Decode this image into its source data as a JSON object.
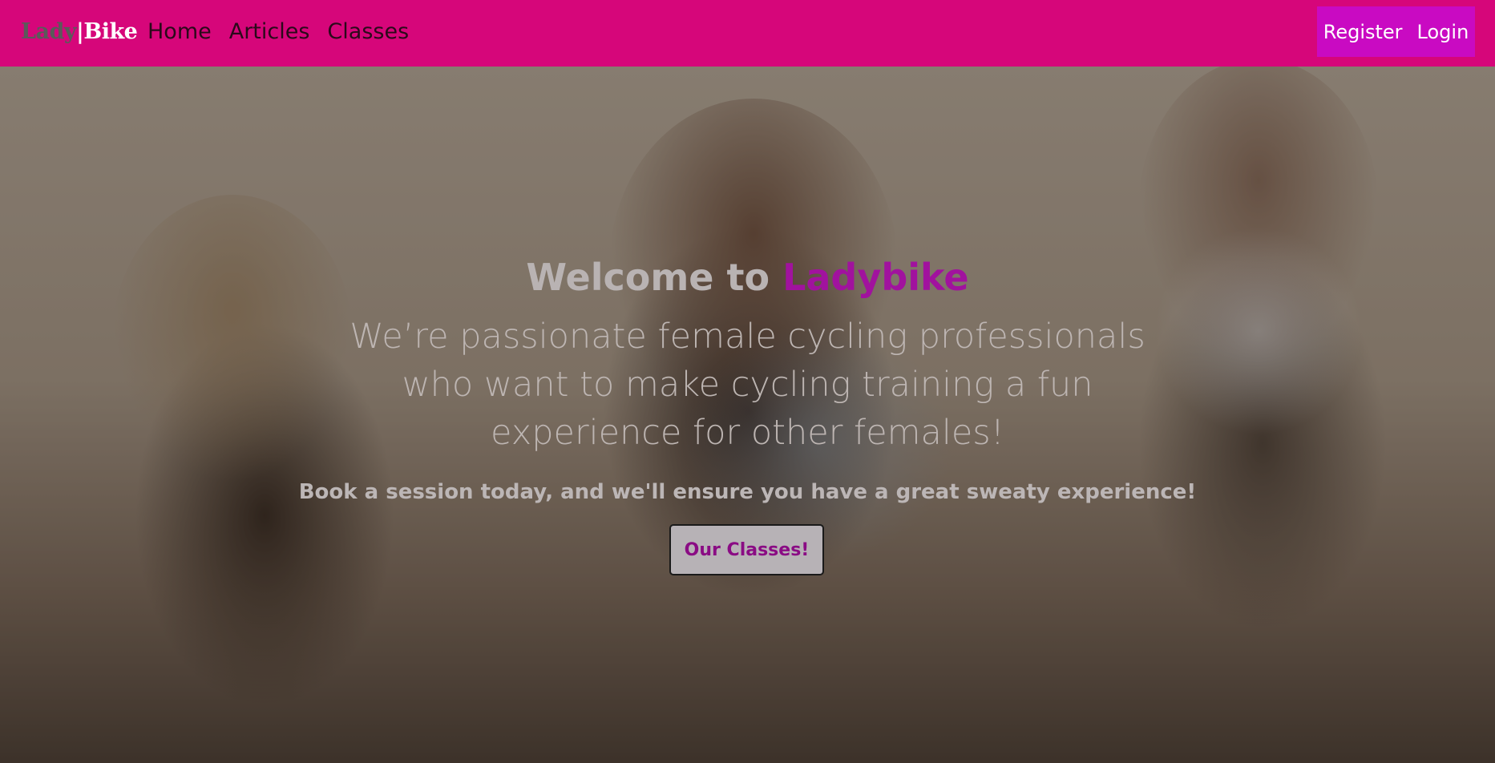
{
  "brand": {
    "part1": "Lady",
    "separator": "|",
    "part2": "Bike"
  },
  "nav": {
    "items": [
      {
        "label": "Home"
      },
      {
        "label": "Articles"
      },
      {
        "label": "Classes"
      }
    ]
  },
  "auth": {
    "register_label": "Register",
    "login_label": "Login"
  },
  "hero": {
    "title_prefix": "Welcome to ",
    "title_accent": "Ladybike",
    "subtitle": "We’re passionate female cycling professionals who want to make cycling training a fun experience for other females!",
    "cta_text": "Book a session today, and we'll ensure you have a great sweaty experience!",
    "cta_button_label": "Our Classes!"
  },
  "colors": {
    "navbar": "#d6067a",
    "auth_box": "#c90ac2",
    "accent": "#a1129e"
  }
}
